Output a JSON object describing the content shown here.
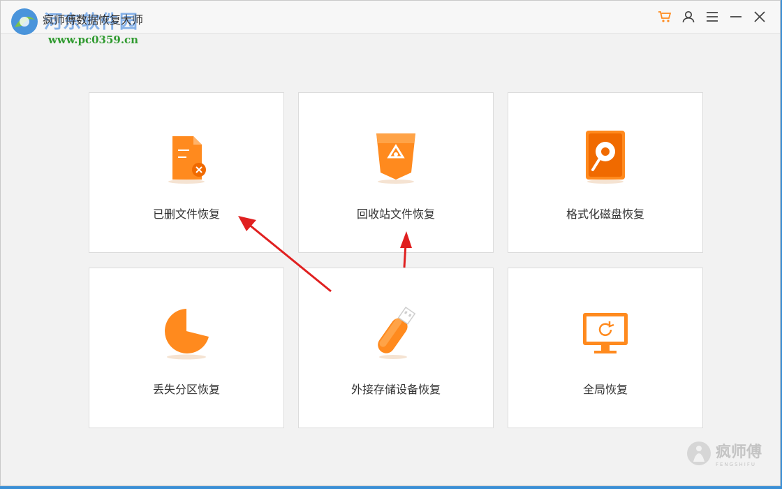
{
  "window": {
    "title": "疯师傅数据恢复大师",
    "watermark_cn": "河东软件园",
    "watermark_url": "www.pc0359.cn"
  },
  "titlebar": {
    "icons": [
      "cart-icon",
      "user-icon",
      "menu-icon",
      "minimize-icon",
      "close-icon"
    ]
  },
  "cards": [
    {
      "label": "已删文件恢复",
      "icon": "deleted-file-icon"
    },
    {
      "label": "回收站文件恢复",
      "icon": "recycle-bin-icon"
    },
    {
      "label": "格式化磁盘恢复",
      "icon": "formatted-disk-icon"
    },
    {
      "label": "丢失分区恢复",
      "icon": "lost-partition-icon"
    },
    {
      "label": "外接存储设备恢复",
      "icon": "usb-drive-icon"
    },
    {
      "label": "全局恢复",
      "icon": "full-recovery-icon"
    }
  ],
  "brand": {
    "name_cn": "疯师傅",
    "name_en": "FENGSHIFU"
  },
  "colors": {
    "accent": "#ff8a1e",
    "accent_dark": "#f06a00",
    "arrow": "#e02020"
  }
}
